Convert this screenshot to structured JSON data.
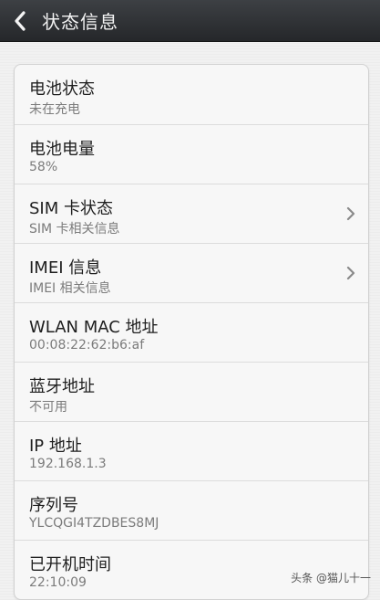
{
  "header": {
    "back_icon": "chevron-left-icon",
    "title": "状态信息"
  },
  "rows": [
    {
      "label": "电池状态",
      "value": "未在充电",
      "chevron": false
    },
    {
      "label": "电池电量",
      "value": "58%",
      "chevron": false
    },
    {
      "label": "SIM 卡状态",
      "value": "SIM 卡相关信息",
      "chevron": true
    },
    {
      "label": "IMEI 信息",
      "value": "IMEI 相关信息",
      "chevron": true
    },
    {
      "label": "WLAN MAC 地址",
      "value": "00:08:22:62:b6:af",
      "chevron": false
    },
    {
      "label": "蓝牙地址",
      "value": "不可用",
      "chevron": false
    },
    {
      "label": "IP 地址",
      "value": "192.168.1.3",
      "chevron": false
    },
    {
      "label": "序列号",
      "value": "YLCQGI4TZDBES8MJ",
      "chevron": false
    },
    {
      "label": "已开机时间",
      "value": "22:10:09",
      "chevron": false
    }
  ],
  "watermark": "头条 @猫儿十一",
  "colors": {
    "titlebar": "#2f3134",
    "background": "#f1f1f1",
    "card": "#f7f7f7",
    "label": "#1e1e1e",
    "value": "#7b7b7b"
  }
}
